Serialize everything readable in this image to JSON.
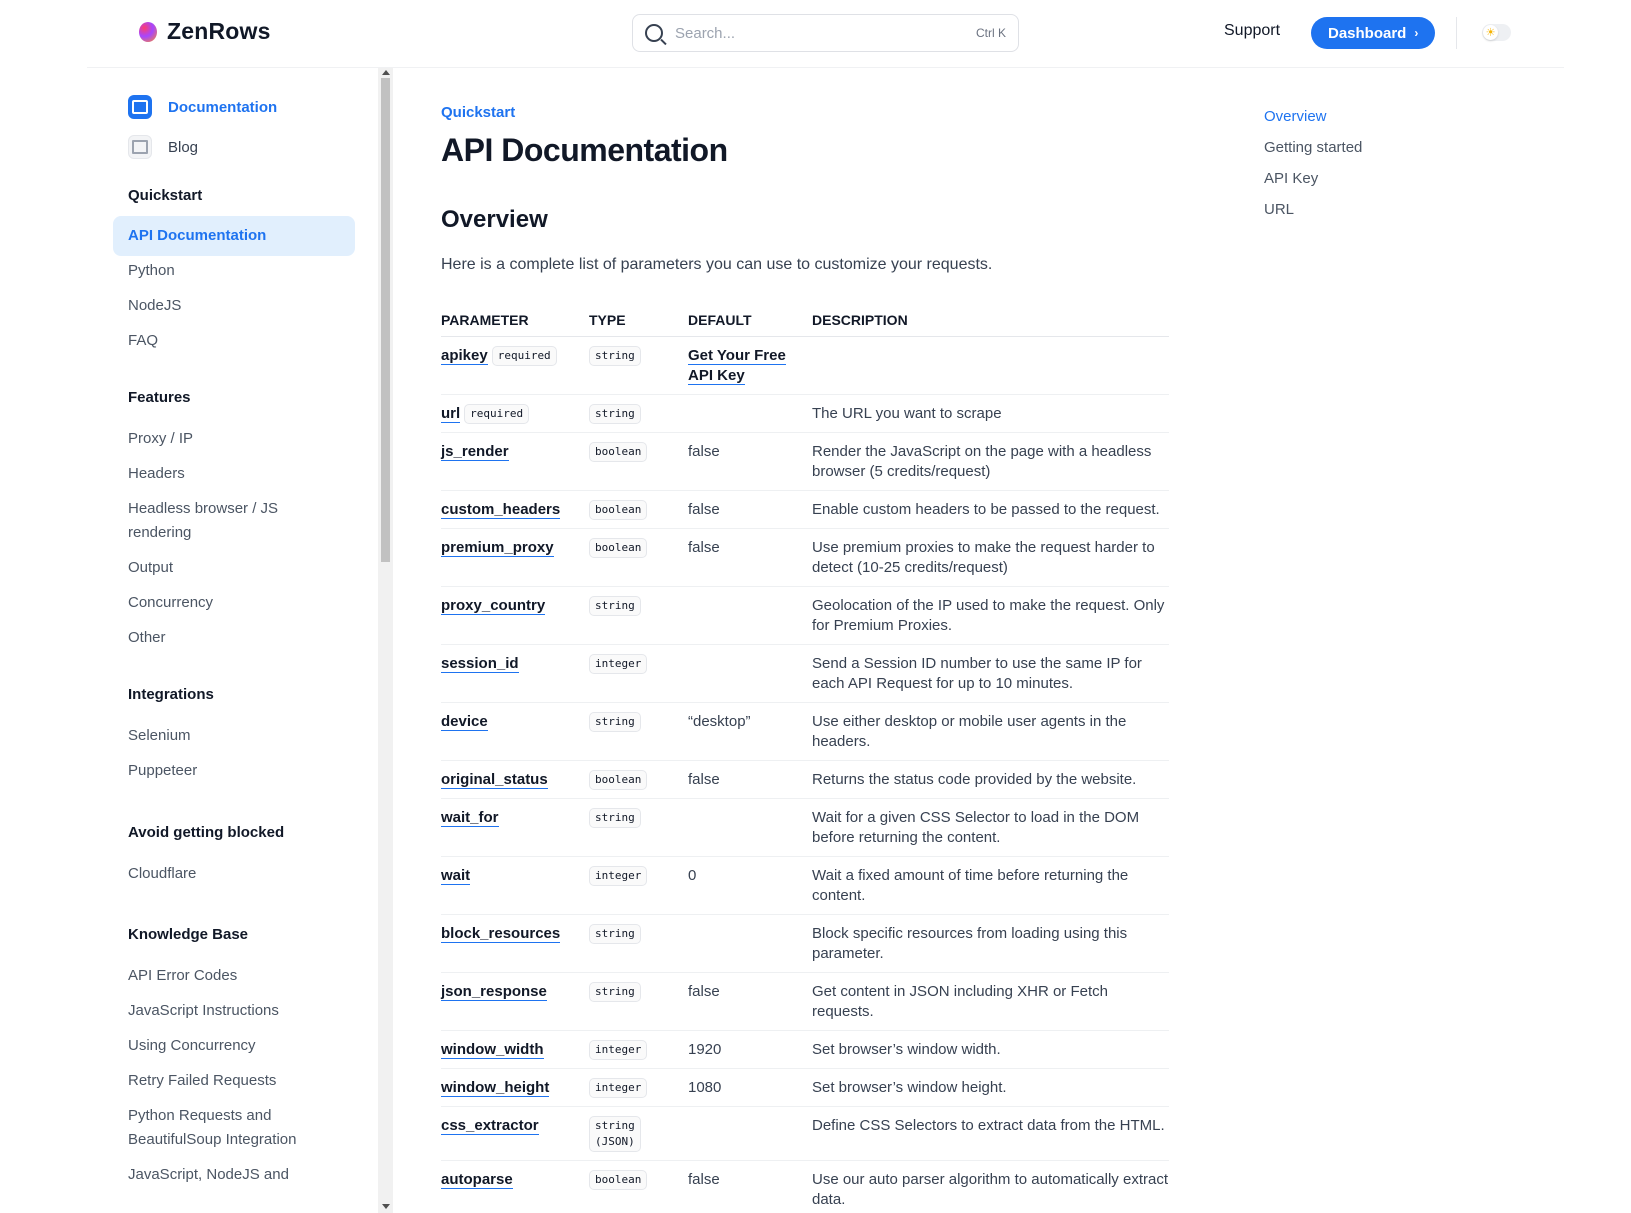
{
  "header": {
    "logo_text": "ZenRows",
    "search_placeholder": "Search...",
    "search_shortcut": "Ctrl K",
    "support_label": "Support",
    "dashboard_label": "Dashboard",
    "dashboard_chevron": "›",
    "theme_icon": "☀"
  },
  "sidebar": {
    "top_links": [
      {
        "label": "Documentation",
        "icon": "book-icon"
      },
      {
        "label": "Blog",
        "icon": "newspaper-icon"
      }
    ],
    "sections": [
      {
        "heading": "Quickstart",
        "items": [
          "API Documentation",
          "Python",
          "NodeJS",
          "FAQ"
        ]
      },
      {
        "heading": "Features",
        "items": [
          "Proxy / IP",
          "Headers",
          "Headless browser / JS rendering",
          "Output",
          "Concurrency",
          "Other"
        ]
      },
      {
        "heading": "Integrations",
        "items": [
          "Selenium",
          "Puppeteer"
        ]
      },
      {
        "heading": "Avoid getting blocked",
        "items": [
          "Cloudflare"
        ]
      },
      {
        "heading": "Knowledge Base",
        "items": [
          "API Error Codes",
          "JavaScript Instructions",
          "Using Concurrency",
          "Retry Failed Requests",
          "Python Requests and BeautifulSoup Integration",
          "JavaScript, NodeJS and"
        ]
      }
    ],
    "active_item": "API Documentation"
  },
  "main": {
    "eyebrow": "Quickstart",
    "title": "API Documentation",
    "section_title": "Overview",
    "intro": "Here is a complete list of parameters you can use to customize your requests.",
    "table": {
      "headers": [
        "PARAMETER",
        "TYPE",
        "DEFAULT",
        "DESCRIPTION"
      ],
      "required_label": "required",
      "rows": [
        {
          "name": "apikey",
          "required": true,
          "type": "string",
          "default": "Get Your Free API Key",
          "default_is_link": true,
          "description": ""
        },
        {
          "name": "url",
          "required": true,
          "type": "string",
          "default": "",
          "description": "The URL you want to scrape"
        },
        {
          "name": "js_render",
          "type": "boolean",
          "default": "false",
          "description": "Render the JavaScript on the page with a headless browser (5 credits/request)"
        },
        {
          "name": "custom_headers",
          "type": "boolean",
          "default": "false",
          "description": "Enable custom headers to be passed to the request."
        },
        {
          "name": "premium_proxy",
          "type": "boolean",
          "default": "false",
          "description": "Use premium proxies to make the request harder to detect (10-25 credits/request)"
        },
        {
          "name": "proxy_country",
          "type": "string",
          "default": "",
          "description": "Geolocation of the IP used to make the request. Only for Premium Proxies."
        },
        {
          "name": "session_id",
          "type": "integer",
          "default": "",
          "description": "Send a Session ID number to use the same IP for each API Request for up to 10 minutes."
        },
        {
          "name": "device",
          "type": "string",
          "default": "“desktop”",
          "description": "Use either desktop or mobile user agents in the headers."
        },
        {
          "name": "original_status",
          "type": "boolean",
          "default": "false",
          "description": "Returns the status code provided by the website."
        },
        {
          "name": "wait_for",
          "type": "string",
          "default": "",
          "description": "Wait for a given CSS Selector to load in the DOM before returning the content."
        },
        {
          "name": "wait",
          "type": "integer",
          "default": "0",
          "description": "Wait a fixed amount of time before returning the content."
        },
        {
          "name": "block_resources",
          "type": "string",
          "default": "",
          "description": "Block specific resources from loading using this parameter."
        },
        {
          "name": "json_response",
          "type": "string",
          "default": "false",
          "description": "Get content in JSON including XHR or Fetch requests."
        },
        {
          "name": "window_width",
          "type": "integer",
          "default": "1920",
          "description": "Set browser’s window width."
        },
        {
          "name": "window_height",
          "type": "integer",
          "default": "1080",
          "description": "Set browser’s window height."
        },
        {
          "name": "css_extractor",
          "type": "string (JSON)",
          "default": "",
          "description": "Define CSS Selectors to extract data from the HTML."
        },
        {
          "name": "autoparse",
          "type": "boolean",
          "default": "false",
          "description": "Use our auto parser algorithm to automatically extract data."
        }
      ]
    }
  },
  "toc": {
    "items": [
      "Overview",
      "Getting started",
      "API Key",
      "URL"
    ],
    "active": "Overview"
  },
  "colors": {
    "accent": "#1e73f0",
    "active_bg": "#e1effd"
  }
}
